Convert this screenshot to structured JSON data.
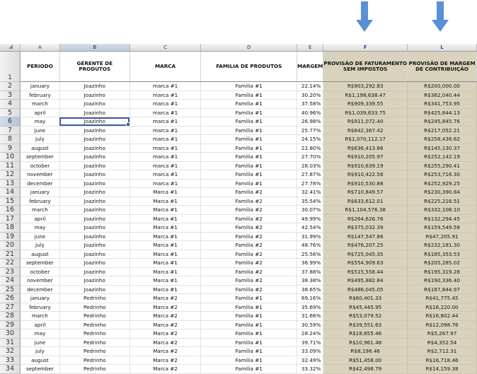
{
  "columns": [
    "A",
    "B",
    "C",
    "D",
    "E",
    "F",
    "L"
  ],
  "header_row_number": "1",
  "headers": {
    "periodo": "PERIODO",
    "gerente": "GERENTE DE PRODUTOS",
    "marca": "MARCA",
    "familia": "FAMILIA DE PRODUTOS",
    "margem": "MARGEM",
    "provisao_faturamento": "PROVISÃO DE FATURAMENTO SEM IMPOSTOS",
    "provisao_margem": "PROVISÃO DE MARGEM DE CONTRIBUIÇÃO"
  },
  "arrow_color": "#5b8fd6",
  "highlight_color": "#d9d3bd",
  "active_cell": "B6",
  "rows": [
    {
      "n": "2",
      "periodo": "january",
      "gerente": "Joazinho",
      "marca": "marca #1",
      "familia": "Familia #1",
      "margem": "22.14%",
      "fat": "R$903,292.83",
      "mc": "R$200,000.00"
    },
    {
      "n": "3",
      "periodo": "february",
      "gerente": "Joazinho",
      "marca": "marca #1",
      "familia": "Familia #1",
      "margem": "30.20%",
      "fat": "R$1,198,638.47",
      "mc": "R$362,040.44"
    },
    {
      "n": "4",
      "periodo": "march",
      "gerente": "Joazinho",
      "marca": "marca #1",
      "familia": "Familia #1",
      "margem": "37.58%",
      "fat": "R$909,339.55",
      "mc": "R$341,753.95"
    },
    {
      "n": "5",
      "periodo": "april",
      "gerente": "Joazinho",
      "marca": "marca #1",
      "familia": "Familia #1",
      "margem": "40.96%",
      "fat": "R$1,039,633.75",
      "mc": "R$425,844.13"
    },
    {
      "n": "6",
      "periodo": "may",
      "gerente": "Joazinho",
      "marca": "marca #1",
      "familia": "Familia #1",
      "margem": "26.98%",
      "fat": "R$911,072.40",
      "mc": "R$245,845.76"
    },
    {
      "n": "7",
      "periodo": "june",
      "gerente": "Joazinho",
      "marca": "marca #1",
      "familia": "Familia #1",
      "margem": "25.77%",
      "fat": "R$842,367.42",
      "mc": "R$217,052.21"
    },
    {
      "n": "8",
      "periodo": "july",
      "gerente": "Joazinho",
      "marca": "marca #1",
      "familia": "Familia #1",
      "margem": "24.15%",
      "fat": "R$1,070,112.17",
      "mc": "R$258,438.62"
    },
    {
      "n": "9",
      "periodo": "august",
      "gerente": "Joazinho",
      "marca": "marca #1",
      "familia": "Familia #1",
      "margem": "22.80%",
      "fat": "R$636,413.66",
      "mc": "R$145,130.37"
    },
    {
      "n": "10",
      "periodo": "september",
      "gerente": "Joazinho",
      "marca": "marca #1",
      "familia": "Familia #1",
      "margem": "27.70%",
      "fat": "R$910,205.97",
      "mc": "R$252,142.19"
    },
    {
      "n": "11",
      "periodo": "october",
      "gerente": "Joazinho",
      "marca": "marca #1",
      "familia": "Familia #1",
      "margem": "28.03%",
      "fat": "R$910,639.19",
      "mc": "R$255,290.41"
    },
    {
      "n": "12",
      "periodo": "november",
      "gerente": "Joazinho",
      "marca": "marca #1",
      "familia": "Familia #1",
      "margem": "27.87%",
      "fat": "R$910,422.58",
      "mc": "R$253,716.30"
    },
    {
      "n": "13",
      "periodo": "december",
      "gerente": "Joazinho",
      "marca": "marca #1",
      "familia": "Familia #1",
      "margem": "27.78%",
      "fat": "R$910,530.88",
      "mc": "R$252,929.25"
    },
    {
      "n": "14",
      "periodo": "january",
      "gerente": "Joazinho",
      "marca": "Marca #1",
      "familia": "Familia #2",
      "margem": "32.41%",
      "fat": "R$710,849.57",
      "mc": "R$230,390.84"
    },
    {
      "n": "15",
      "periodo": "february",
      "gerente": "Joazinho",
      "marca": "Marca #1",
      "familia": "Familia #2",
      "margem": "35.54%",
      "fat": "R$633,612.01",
      "mc": "R$225,216.51"
    },
    {
      "n": "16",
      "periodo": "march",
      "gerente": "Joazinho",
      "marca": "Marca #1",
      "familia": "Familia #2",
      "margem": "30.07%",
      "fat": "R$1,104,576.38",
      "mc": "R$332,108.10"
    },
    {
      "n": "17",
      "periodo": "april",
      "gerente": "Joazinho",
      "marca": "Marca #1",
      "familia": "Familia #2",
      "margem": "49.99%",
      "fat": "R$264,626.76",
      "mc": "R$132,294.45"
    },
    {
      "n": "18",
      "periodo": "may",
      "gerente": "Joazinho",
      "marca": "Marca #1",
      "familia": "Familia #2",
      "margem": "42.54%",
      "fat": "R$375,032.39",
      "mc": "R$159,549.58"
    },
    {
      "n": "19",
      "periodo": "june",
      "gerente": "Joazinho",
      "marca": "Marca #1",
      "familia": "Familia #2",
      "margem": "31.99%",
      "fat": "R$147,547.86",
      "mc": "R$47,205.91"
    },
    {
      "n": "20",
      "periodo": "july",
      "gerente": "Joazinho",
      "marca": "Marca #1",
      "familia": "Familia #2",
      "margem": "48.76%",
      "fat": "R$476,207.25",
      "mc": "R$232,181.30"
    },
    {
      "n": "21",
      "periodo": "august",
      "gerente": "Joazinho",
      "marca": "Marca #1",
      "familia": "Familia #2",
      "margem": "25.56%",
      "fat": "R$725,045.35",
      "mc": "R$185,353.53"
    },
    {
      "n": "22",
      "periodo": "september",
      "gerente": "Joazinho",
      "marca": "Marca #1",
      "familia": "Familia #2",
      "margem": "36.99%",
      "fat": "R$554,909.63",
      "mc": "R$205,285.02"
    },
    {
      "n": "23",
      "periodo": "october",
      "gerente": "Joazinho",
      "marca": "Marca #1",
      "familia": "Familia #2",
      "margem": "37.88%",
      "fat": "R$515,558.44",
      "mc": "R$195,319.28"
    },
    {
      "n": "24",
      "periodo": "november",
      "gerente": "Joazinho",
      "marca": "Marca #1",
      "familia": "Familia #2",
      "margem": "38.38%",
      "fat": "R$495,882.84",
      "mc": "R$190,336.40"
    },
    {
      "n": "25",
      "periodo": "december",
      "gerente": "Joazinho",
      "marca": "Marca #1",
      "familia": "Familia #2",
      "margem": "38.65%",
      "fat": "R$486,045.05",
      "mc": "R$187,844.97"
    },
    {
      "n": "26",
      "periodo": "january",
      "gerente": "Pedrinho",
      "marca": "Marca #2",
      "familia": "Familia #1",
      "margem": "69.16%",
      "fat": "R$60,401.33",
      "mc": "R$41,775.45"
    },
    {
      "n": "27",
      "periodo": "february",
      "gerente": "Pedrinho",
      "marca": "Marca #2",
      "familia": "Familia #1",
      "margem": "35.69%",
      "fat": "R$45,445.95",
      "mc": "R$16,220.00"
    },
    {
      "n": "28",
      "periodo": "march",
      "gerente": "Pedrinho",
      "marca": "Marca #2",
      "familia": "Familia #1",
      "margem": "31.66%",
      "fat": "R$53,079.52",
      "mc": "R$16,802.44"
    },
    {
      "n": "29",
      "periodo": "april",
      "gerente": "Pedrinho",
      "marca": "Marca #2",
      "familia": "Familia #1",
      "margem": "30.59%",
      "fat": "R$39,551.63",
      "mc": "R$12,098.76"
    },
    {
      "n": "30",
      "periodo": "may",
      "gerente": "Pedrinho",
      "marca": "Marca #2",
      "familia": "Familia #1",
      "margem": "28.24%",
      "fat": "R$18,655.46",
      "mc": "R$5,267.97"
    },
    {
      "n": "31",
      "periodo": "june",
      "gerente": "Pedrinho",
      "marca": "Marca #2",
      "familia": "Familia #1",
      "margem": "39.71%",
      "fat": "R$10,961.48",
      "mc": "R$4,352.54"
    },
    {
      "n": "32",
      "periodo": "july",
      "gerente": "Pedrinho",
      "marca": "Marca #2",
      "familia": "Familia #1",
      "margem": "33.09%",
      "fat": "R$8,196.46",
      "mc": "R$2,712.31"
    },
    {
      "n": "33",
      "periodo": "august",
      "gerente": "Pedrinho",
      "marca": "Marca #2",
      "familia": "Familia #1",
      "margem": "32.49%",
      "fat": "R$51,458.00",
      "mc": "R$16,718.46"
    },
    {
      "n": "34",
      "periodo": "september",
      "gerente": "Pedrinho",
      "marca": "Marca #2",
      "familia": "Familia #1",
      "margem": "33.32%",
      "fat": "R$42,498.79",
      "mc": "R$14,159.38"
    }
  ]
}
